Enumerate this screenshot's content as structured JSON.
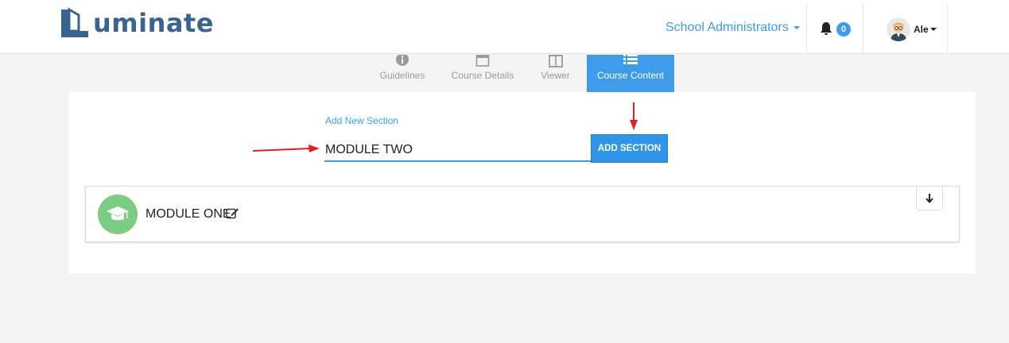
{
  "header": {
    "brand": "uminate",
    "role_label": "School Administrators",
    "notification_count": "0",
    "user_name": "Ale"
  },
  "tabs": [
    {
      "label": "Guidelines",
      "icon": "info-circle-icon",
      "active": false
    },
    {
      "label": "Course Details",
      "icon": "calendar-icon",
      "active": false
    },
    {
      "label": "Viewer",
      "icon": "columns-icon",
      "active": false
    },
    {
      "label": "Course Content",
      "icon": "list-icon",
      "active": true
    }
  ],
  "form": {
    "label": "Add New Section",
    "input_value": "MODULE TWO",
    "button_label": "ADD SECTION"
  },
  "modules": [
    {
      "title": "MODULE ONE",
      "icon": "graduation-cap-icon"
    }
  ],
  "colors": {
    "accent": "#3d9be9",
    "brand": "#3b6390",
    "module_icon_bg": "#7ccd84",
    "annotation_arrow": "#e02020"
  }
}
